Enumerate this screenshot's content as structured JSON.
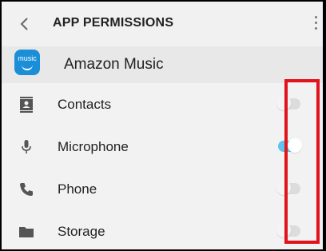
{
  "header": {
    "title": "APP PERMISSIONS"
  },
  "app": {
    "name": "Amazon Music",
    "icon_text": "music",
    "icon_color": "#1a8fd8"
  },
  "permissions": [
    {
      "label": "Contacts",
      "icon": "contacts-icon",
      "enabled": false
    },
    {
      "label": "Microphone",
      "icon": "microphone-icon",
      "enabled": true
    },
    {
      "label": "Phone",
      "icon": "phone-icon",
      "enabled": false
    },
    {
      "label": "Storage",
      "icon": "folder-icon",
      "enabled": false
    }
  ],
  "colors": {
    "toggle_on": "#5bc4f0",
    "highlight": "#e0141a"
  }
}
